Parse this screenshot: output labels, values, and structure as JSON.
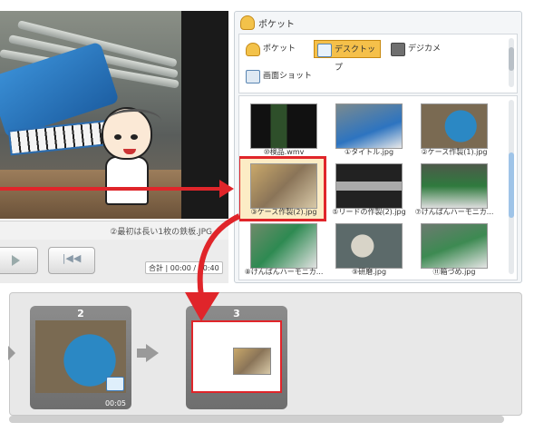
{
  "preview": {
    "caption": "②最初は長い1枚の鉄板.JPG",
    "total_label": "合計",
    "time": "00:00 / 00:40"
  },
  "pocket": {
    "title": "ポケット",
    "tabs": [
      {
        "label": "ポケット",
        "icon": "pocket-icon"
      },
      {
        "label": "デスクトップ",
        "icon": "desktop-icon",
        "selected": true
      },
      {
        "label": "デジカメ",
        "icon": "camera-icon"
      },
      {
        "label": "画面ショット",
        "icon": "screenshot-icon"
      }
    ],
    "thumbnails": [
      {
        "label": "⑩検品.wmv"
      },
      {
        "label": "①タイトル.jpg"
      },
      {
        "label": "②ケース作製(1).jpg"
      },
      {
        "label": "③ケース作製(2).jpg",
        "selected": true
      },
      {
        "label": "⑤リードの作製(2).jpg"
      },
      {
        "label": "⑦けんばんハーモニカ..."
      },
      {
        "label": "⑧けんばんハーモニカ..."
      },
      {
        "label": "⑨研磨.jpg"
      },
      {
        "label": "⑪箱づめ.jpg"
      }
    ]
  },
  "timeline": {
    "clips": [
      {
        "number": "2",
        "duration": "00:05"
      },
      {
        "number": "3"
      }
    ]
  },
  "colors": {
    "accent": "#f5c04a",
    "annotation": "#e0252a"
  }
}
